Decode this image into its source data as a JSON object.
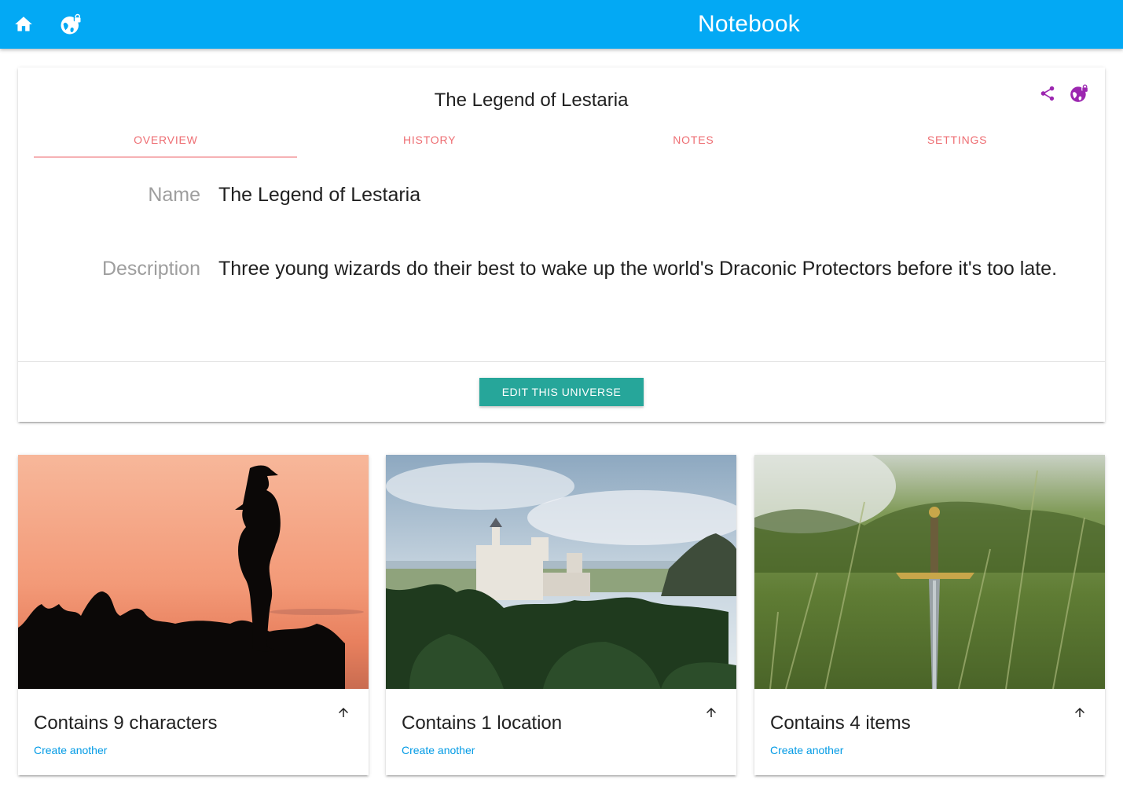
{
  "topbar": {
    "brand": "Notebook",
    "bg_color": "#03a9f4",
    "icons": [
      "home-icon",
      "globe-lock-icon"
    ]
  },
  "universe": {
    "title": "The Legend of Lestaria",
    "action_icons": [
      "share-icon",
      "globe-lock-icon"
    ],
    "tabs": [
      {
        "label": "Overview",
        "active": true
      },
      {
        "label": "History",
        "active": false
      },
      {
        "label": "Notes",
        "active": false
      },
      {
        "label": "Settings",
        "active": false
      }
    ],
    "fields": [
      {
        "label": "Name",
        "value": "The Legend of Lestaria"
      },
      {
        "label": "Description",
        "value": "Three young wizards do their best to wake up the world's Draconic Protectors before it's too late."
      }
    ],
    "edit_button": "Edit this universe"
  },
  "content_cards": [
    {
      "count_text": "Contains 9 characters",
      "link": "Create another",
      "image": "silhouette-at-sunset"
    },
    {
      "count_text": "Contains 1 location",
      "link": "Create another",
      "image": "castle-on-forested-hill"
    },
    {
      "count_text": "Contains 4 items",
      "link": "Create another",
      "image": "sword-in-grass"
    }
  ],
  "colors": {
    "accent_tab": "#ee6e73",
    "button": "#26a69a",
    "link": "#039be5",
    "action_icon": "#9c27b0"
  }
}
